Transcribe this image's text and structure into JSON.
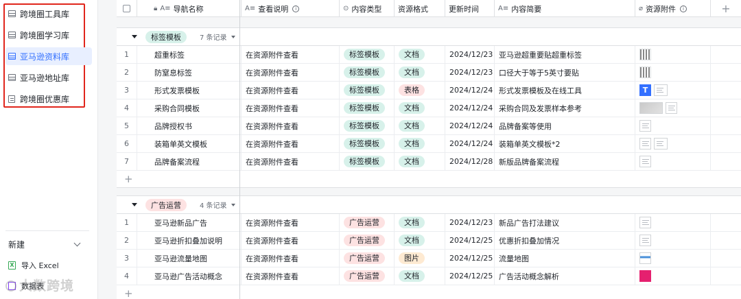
{
  "sidebar": {
    "items": [
      {
        "label": "跨境圈工具库"
      },
      {
        "label": "跨境圈学习库"
      },
      {
        "label": "亚马逊资料库"
      },
      {
        "label": "亚马逊地址库"
      },
      {
        "label": "跨境圈优惠库"
      }
    ],
    "new_label": "新建",
    "import_excel": "导入 Excel",
    "dashboard": "数据表"
  },
  "header": {
    "columns": [
      {
        "icon": "lock-icon",
        "prefix": "A≡",
        "label": "导航名称"
      },
      {
        "prefix": "A≡",
        "label": "查看说明"
      },
      {
        "prefix": "⊙",
        "label": "内容类型"
      },
      {
        "label": "资源格式"
      },
      {
        "label": "更新时间"
      },
      {
        "prefix": "A≡",
        "label": "内容简要"
      },
      {
        "prefix": "⌀",
        "label": "资源附件"
      }
    ]
  },
  "groups": [
    {
      "tag": "标签模板",
      "count": "7 条记录",
      "rows": [
        {
          "n": "1",
          "name": "超重标签",
          "view": "在资源附件查看",
          "type": "标签模板",
          "format": "文档",
          "date": "2024/12/23",
          "summary": "亚马逊超重要贴超重标签"
        },
        {
          "n": "2",
          "name": "防窒息标签",
          "view": "在资源附件查看",
          "type": "标签模板",
          "format": "文档",
          "date": "2024/12/23",
          "summary": "口径大于等于5英寸要贴"
        },
        {
          "n": "3",
          "name": "形式发票模板",
          "view": "在资源附件查看",
          "type": "标签模板",
          "format": "表格",
          "date": "2024/12/24",
          "summary": "形式发票模板及在线工具"
        },
        {
          "n": "4",
          "name": "采购合同模板",
          "view": "在资源附件查看",
          "type": "标签模板",
          "format": "文档",
          "date": "2024/12/24",
          "summary": "采购合同及发票样本参考"
        },
        {
          "n": "5",
          "name": "品牌授权书",
          "view": "在资源附件查看",
          "type": "标签模板",
          "format": "文档",
          "date": "2024/12/24",
          "summary": "品牌备案等使用"
        },
        {
          "n": "6",
          "name": "装箱单英文模板",
          "view": "在资源附件查看",
          "type": "标签模板",
          "format": "文档",
          "date": "2024/12/24",
          "summary": "装箱单英文模板*2"
        },
        {
          "n": "7",
          "name": "品牌备案流程",
          "view": "在资源附件查看",
          "type": "标签模板",
          "format": "文档",
          "date": "2024/12/28",
          "summary": "新版品牌备案流程"
        }
      ]
    },
    {
      "tag": "广告运营",
      "count": "4 条记录",
      "rows": [
        {
          "n": "1",
          "name": "亚马逊新品广告",
          "view": "在资源附件查看",
          "type": "广告运营",
          "format": "文档",
          "date": "2024/12/23",
          "summary": "新品广告打法建议"
        },
        {
          "n": "2",
          "name": "亚马逊折扣叠加说明",
          "view": "在资源附件查看",
          "type": "广告运营",
          "format": "文档",
          "date": "2024/12/25",
          "summary": "优惠折扣叠加情况"
        },
        {
          "n": "3",
          "name": "亚马逊流量地图",
          "view": "在资源附件查看",
          "type": "广告运营",
          "format": "图片",
          "date": "2024/12/25",
          "summary": "流量地图"
        },
        {
          "n": "4",
          "name": "亚马逊广告活动概念",
          "view": "在资源附件查看",
          "type": "广告运营",
          "format": "文档",
          "date": "2024/12/25",
          "summary": "广告活动概念解析"
        }
      ]
    }
  ],
  "colors": {
    "accent": "#3370ff",
    "highlight_box": "#e0251b",
    "tag_green_bg": "#d7f1ea",
    "tag_red_bg": "#fde2e2",
    "tag_orange_bg": "#feead2",
    "doc_tag_bg": "#d7f1ea"
  },
  "watermark": "大数跨境"
}
